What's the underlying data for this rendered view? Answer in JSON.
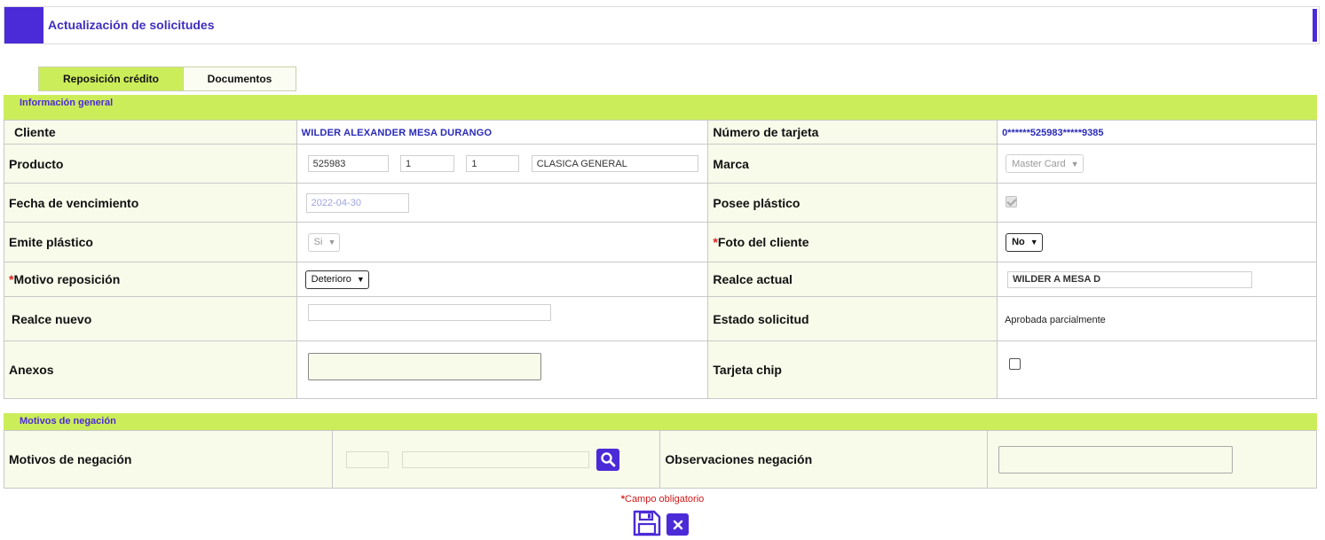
{
  "header": {
    "title": "Actualización de solicitudes"
  },
  "tabs": [
    {
      "label": "Reposición crédito",
      "active": true
    },
    {
      "label": "Documentos",
      "active": false
    }
  ],
  "info_section": {
    "title": "Información general",
    "cliente_label": "Cliente",
    "cliente_value": "WILDER ALEXANDER MESA DURANGO",
    "numero_tarjeta_label": "Número de tarjeta",
    "numero_tarjeta_value": "0******525983*****9385",
    "producto_label": "Producto",
    "producto_fields": [
      "525983",
      "1",
      "1",
      "CLASICA GENERAL"
    ],
    "marca_label": "Marca",
    "marca_value": "Master Card",
    "fecha_label": "Fecha de vencimiento",
    "fecha_value": "2022-04-30",
    "posee_label": "Posee plástico",
    "emite_label": "Emite plástico",
    "emite_value": "Si",
    "foto_label": "Foto del cliente",
    "foto_value": "No",
    "motivo_label": "Motivo reposición",
    "motivo_value": "Deterioro",
    "realce_actual_label": "Realce actual",
    "realce_actual_value": "WILDER A MESA D",
    "realce_nuevo_label": "Realce nuevo",
    "estado_label": "Estado solicitud",
    "estado_value": "Aprobada parcialmente",
    "anexos_label": "Anexos",
    "chip_label": "Tarjeta chip"
  },
  "negacion_section": {
    "title": "Motivos de negación",
    "motivos_label": "Motivos de negación",
    "observaciones_label": "Observaciones negación"
  },
  "footer": {
    "required_marker": "*",
    "required_text": "Campo obligatorio"
  },
  "colors": {
    "accent": "#4b2bd7",
    "section_green": "#cced5a",
    "row_bg": "#f8faea",
    "required_red": "#e02020"
  }
}
